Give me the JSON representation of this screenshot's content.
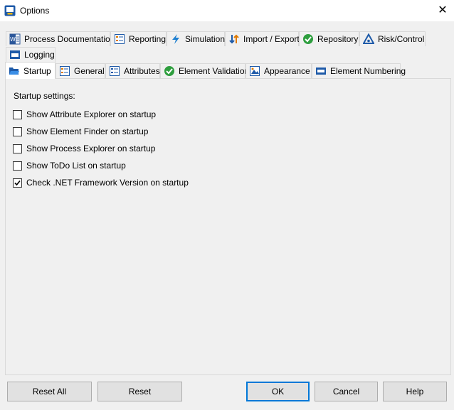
{
  "window": {
    "title": "Options",
    "close_glyph": "✕"
  },
  "tabs_row1": [
    {
      "label": "Process Documentation",
      "icon": "word-document-icon"
    },
    {
      "label": "Reporting",
      "icon": "report-list-icon"
    },
    {
      "label": "Simulation",
      "icon": "lightning-icon"
    },
    {
      "label": "Import / Export",
      "icon": "import-export-arrows-icon"
    },
    {
      "label": "Repository",
      "icon": "green-check-icon"
    },
    {
      "label": "Risk/Control",
      "icon": "risk-triangle-icon"
    }
  ],
  "tabs_row2": [
    {
      "label": "Logging",
      "icon": "logging-window-icon"
    }
  ],
  "tabs_row3": [
    {
      "label": "Startup",
      "icon": "folder-open-icon",
      "active": true
    },
    {
      "label": "General",
      "icon": "general-list-icon"
    },
    {
      "label": "Attributes",
      "icon": "attributes-list-icon"
    },
    {
      "label": "Element Validation",
      "icon": "validation-check-icon"
    },
    {
      "label": "Appearance",
      "icon": "appearance-icon"
    },
    {
      "label": "Element Numbering",
      "icon": "numbering-icon"
    }
  ],
  "startup": {
    "section_label": "Startup settings:",
    "options": [
      {
        "label": "Show Attribute Explorer on startup",
        "checked": false
      },
      {
        "label": "Show Element Finder on startup",
        "checked": false
      },
      {
        "label": "Show Process Explorer on startup",
        "checked": false
      },
      {
        "label": "Show ToDo List on startup",
        "checked": false
      },
      {
        "label": "Check .NET Framework Version on startup",
        "checked": true
      }
    ]
  },
  "buttons": {
    "reset_all": "Reset All",
    "reset": "Reset",
    "ok": "OK",
    "cancel": "Cancel",
    "help": "Help"
  },
  "colors": {
    "accent": "#0078d7",
    "check_green": "#2e9e3e",
    "icon_blue": "#1e5aa8"
  }
}
